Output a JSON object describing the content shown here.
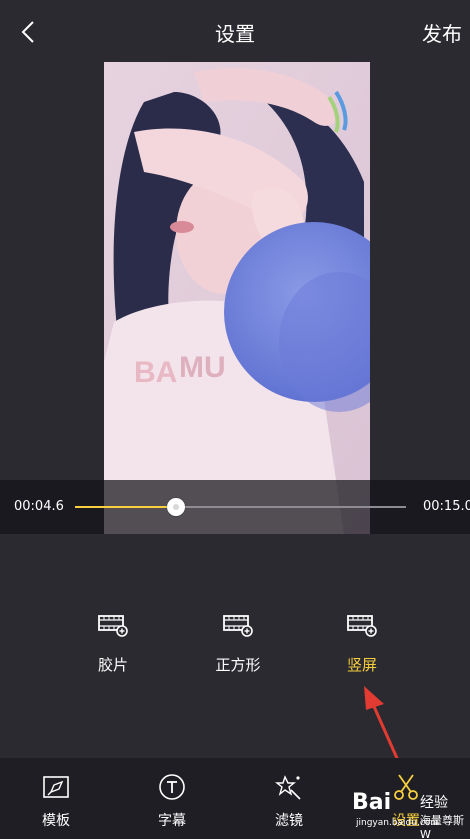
{
  "header": {
    "title": "设置",
    "publish_label": "发布"
  },
  "player": {
    "current_time": "00:04.6",
    "total_time": "00:15.0",
    "progress": 0.306
  },
  "ratio_options": [
    {
      "label": "胶片",
      "icon": "film-icon",
      "active": false
    },
    {
      "label": "正方形",
      "icon": "film-icon",
      "active": false
    },
    {
      "label": "竖屏",
      "icon": "film-icon",
      "active": true
    }
  ],
  "bottom_nav": [
    {
      "label": "模板",
      "icon": "template-icon",
      "active": false
    },
    {
      "label": "字幕",
      "icon": "text-icon",
      "active": false
    },
    {
      "label": "滤镜",
      "icon": "magic-wand-icon",
      "active": false
    },
    {
      "label": "设置",
      "icon": "scissors-icon",
      "active": true
    }
  ],
  "watermark": {
    "brand": "Bai",
    "brand_suffix": "经验",
    "url": "jingyan.baidu.com",
    "author": "海量尊斯W"
  },
  "colors": {
    "accent": "#f7cf3f",
    "background": "#2b2a30",
    "bottom_bar": "#1f1e24",
    "annotation": "#e23b32"
  }
}
